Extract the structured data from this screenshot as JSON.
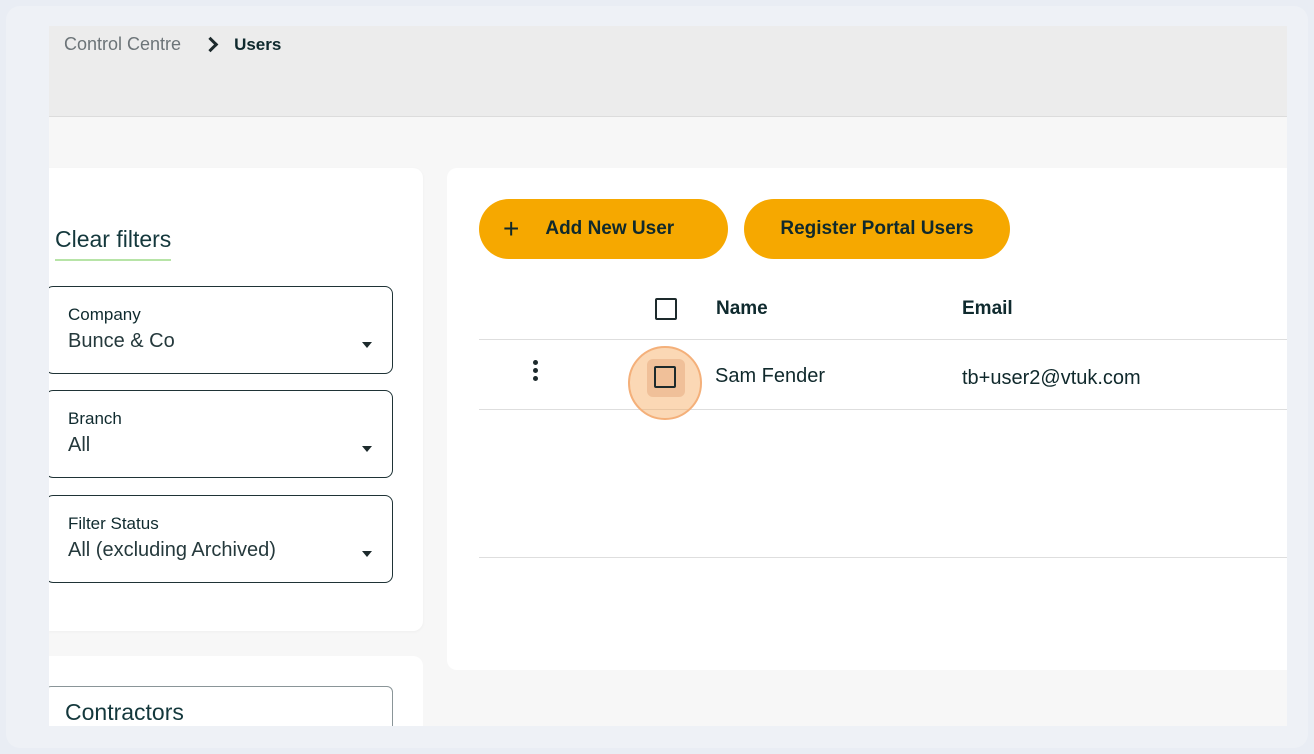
{
  "breadcrumb": {
    "root": "Control Centre",
    "current": "Users"
  },
  "filters": {
    "clear_label": "Clear filters",
    "company": {
      "label": "Company",
      "value": "Bunce & Co"
    },
    "branch": {
      "label": "Branch",
      "value": "All"
    },
    "status": {
      "label": "Filter Status",
      "value": "All (excluding Archived)"
    }
  },
  "contractors": {
    "label": "Contractors"
  },
  "toolbar": {
    "add_plus": "+",
    "add_label": "Add New User",
    "register_label": "Register Portal Users"
  },
  "table": {
    "columns": {
      "name": "Name",
      "email": "Email"
    },
    "rows": [
      {
        "name": "Sam Fender",
        "email": "tb+user2@vtuk.com"
      }
    ]
  },
  "colors": {
    "accent": "#f6a800",
    "underline": "#b7e4a7",
    "highlight": "#f4b07a"
  }
}
